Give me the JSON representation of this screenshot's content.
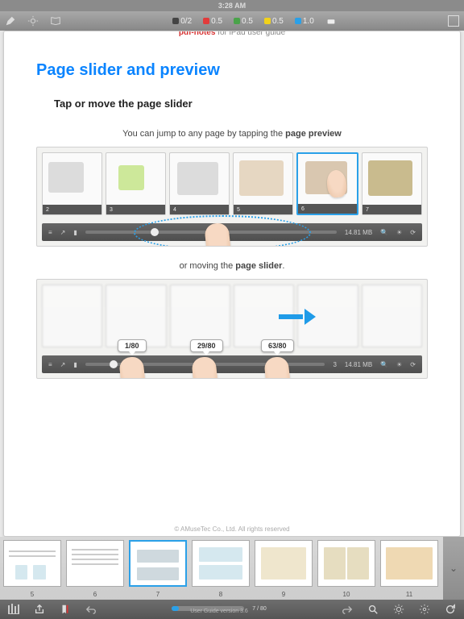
{
  "status": {
    "time": "3:28 AM"
  },
  "top_toolbar": {
    "pens": [
      {
        "label": "0/2",
        "color": "#444444"
      },
      {
        "label": "0.5",
        "color": "#e23b3b"
      },
      {
        "label": "0.5",
        "color": "#4aa34a"
      },
      {
        "label": "0.5",
        "color": "#f2d21a"
      },
      {
        "label": "1.0",
        "color": "#2aa0e8"
      }
    ]
  },
  "document": {
    "header_brand": "pdf-notes",
    "header_rest": " for iPad user guide",
    "section_title": "Page slider and preview",
    "step_title": "Tap or move the page slider",
    "instr1_pre": "You can jump to any page by tapping the ",
    "instr1_bold": "page preview",
    "instr2_pre": "or moving the ",
    "instr2_bold": "page slider",
    "instr2_post": ".",
    "copyright": "© AMuseTec Co., Ltd. All rights reserved"
  },
  "illus1": {
    "thumbs": [
      "2",
      "3",
      "4",
      "5",
      "6",
      "7"
    ],
    "selected_index": 4,
    "size_label": "14.81 MB"
  },
  "illus2": {
    "bubbles": [
      "1/80",
      "29/80",
      "63/80"
    ],
    "page_center": "3",
    "size_label": "14.81 MB"
  },
  "strip": {
    "pages": [
      "5",
      "6",
      "7",
      "8",
      "9",
      "10",
      "11"
    ],
    "current": "7"
  },
  "bottom": {
    "page_indicator": "7 / 80",
    "big_page": "7",
    "version": "User Guide version 3.6"
  }
}
